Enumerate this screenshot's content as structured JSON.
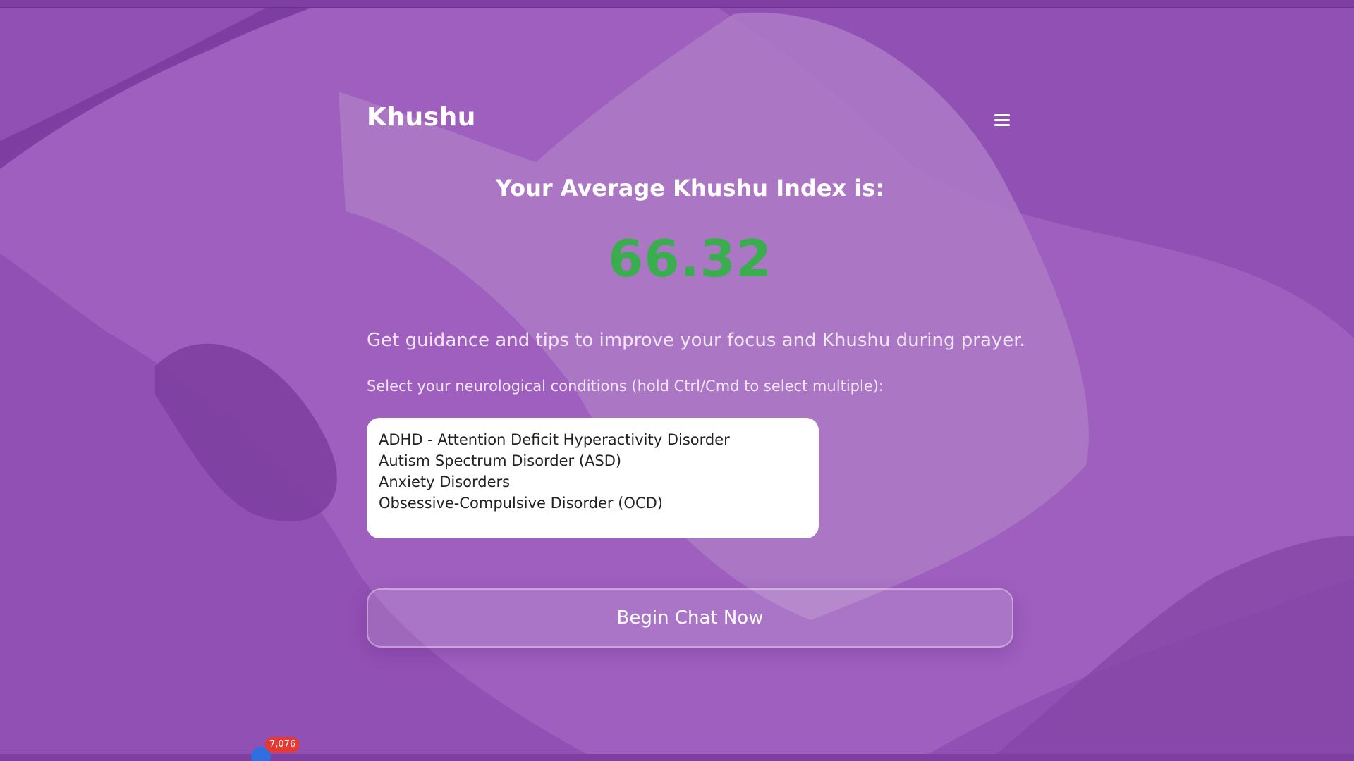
{
  "app": {
    "brand": "Khushu"
  },
  "result": {
    "heading": "Your Average Khushu Index is:",
    "score": "66.32",
    "score_color": "#3aae4f"
  },
  "guidance": {
    "tagline": "Get guidance and tips to improve your focus and Khushu during prayer.",
    "select_label": "Select your neurological conditions (hold Ctrl/Cmd to select multiple):",
    "options": [
      "ADHD - Attention Deficit Hyperactivity Disorder",
      "Autism Spectrum Disorder (ASD)",
      "Anxiety Disorders",
      "Obsessive-Compulsive Disorder (OCD)"
    ]
  },
  "actions": {
    "begin_chat_label": "Begin Chat Now"
  },
  "notification": {
    "count": "7,076"
  },
  "icons": {
    "menu": "hamburger-menu-icon"
  },
  "colors": {
    "background": "#9150b3",
    "accent_green": "#3aae4f"
  }
}
